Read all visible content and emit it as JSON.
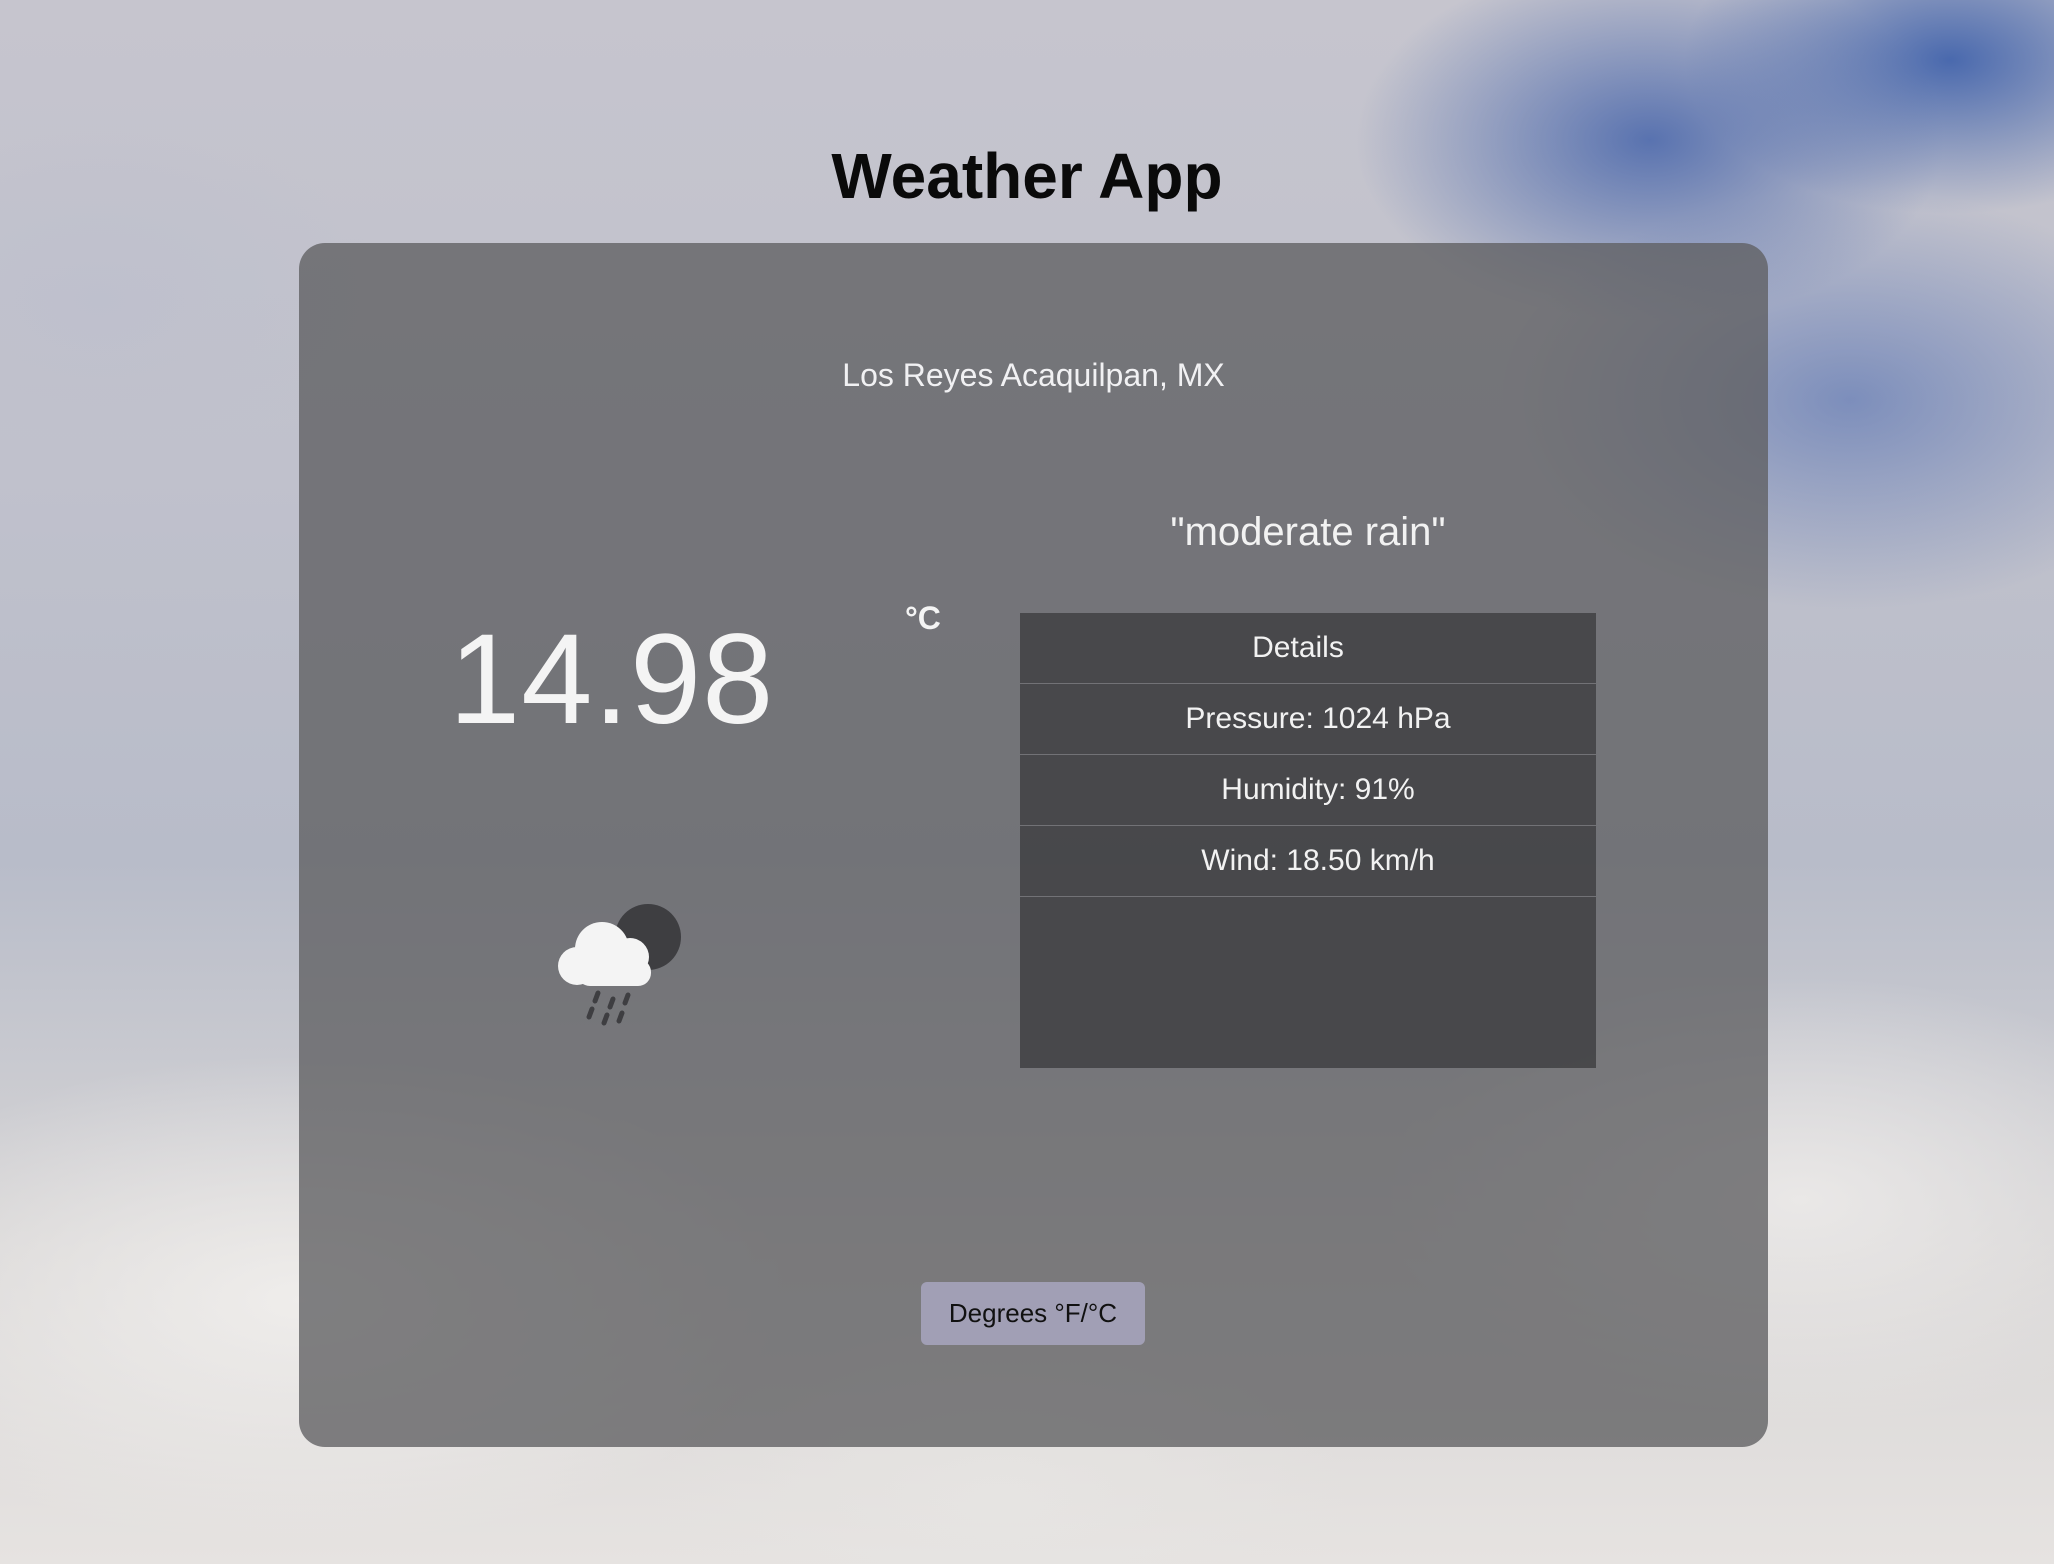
{
  "app": {
    "title": "Weather App"
  },
  "weather": {
    "location": "Los Reyes Acaquilpan, MX",
    "temperature": "14.98",
    "unit": "°C",
    "description": "\"moderate rain\"",
    "icon": "cloud-sun-rain-icon"
  },
  "details": {
    "header": "Details",
    "items": [
      "Pressure: 1024 hPa",
      "Humidity: 91%",
      "Wind: 18.50 km/h"
    ]
  },
  "controls": {
    "toggle_label": "Degrees °F/°C"
  },
  "colors": {
    "card": "#5f5f62",
    "panel": "#3e3e41",
    "button": "#a19fb5",
    "text": "#f4f4f4"
  }
}
